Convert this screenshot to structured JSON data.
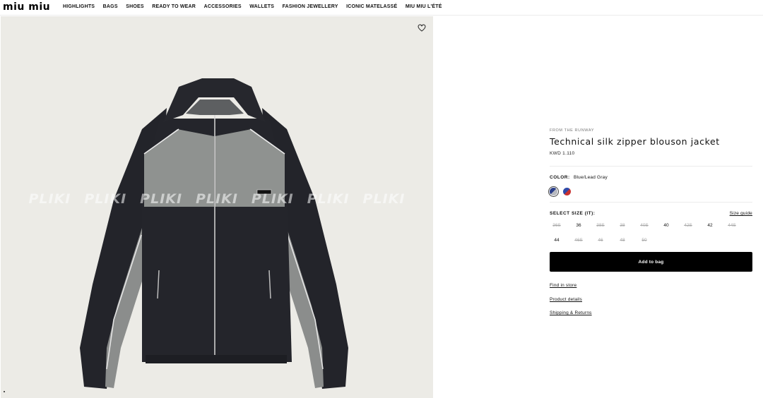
{
  "header": {
    "logo": "miu miu",
    "nav": [
      {
        "label": "HIGHLIGHTS"
      },
      {
        "label": "BAGS"
      },
      {
        "label": "SHOES"
      },
      {
        "label": "READY TO WEAR"
      },
      {
        "label": "ACCESSORIES"
      },
      {
        "label": "WALLETS"
      },
      {
        "label": "FASHION JEWELLERY"
      },
      {
        "label": "ICONIC MATELASSÉ"
      },
      {
        "label": "MIU MIU L'ÉTÉ"
      }
    ]
  },
  "gallery": {
    "favorite_icon": "heart-outline-icon",
    "watermark": [
      "PLIKI",
      "PLIKI",
      "PLIKI",
      "PLIKI",
      "PLIKI",
      "PLIKI",
      "PLIKI"
    ],
    "background": "#ecebe6"
  },
  "product": {
    "eyebrow": "FROM THE RUNWAY",
    "title": "Technical silk zipper blouson jacket",
    "price": "KWD 1.110",
    "color_label": "COLOR:",
    "color_value": "Blue/Lead Gray",
    "swatches": [
      {
        "name": "Blue/Lead Gray",
        "colors": [
          "#2b3f8a",
          "#b7b9c0"
        ],
        "selected": true
      },
      {
        "name": "Blue/Red",
        "colors": [
          "#2f4aa8",
          "#c8302e"
        ],
        "selected": false
      }
    ],
    "size_label": "SELECT SIZE (IT):",
    "size_guide": "Size guide",
    "sizes": [
      {
        "label": "36S",
        "available": false
      },
      {
        "label": "36",
        "available": true
      },
      {
        "label": "38S",
        "available": false
      },
      {
        "label": "38",
        "available": false
      },
      {
        "label": "40S",
        "available": false
      },
      {
        "label": "40",
        "available": true
      },
      {
        "label": "42S",
        "available": false
      },
      {
        "label": "42",
        "available": true
      },
      {
        "label": "44S",
        "available": false
      },
      {
        "label": "44",
        "available": true
      },
      {
        "label": "46S",
        "available": false
      },
      {
        "label": "46",
        "available": false
      },
      {
        "label": "48",
        "available": false
      },
      {
        "label": "50",
        "available": false
      }
    ],
    "add_to_bag": "Add to bag",
    "links": [
      {
        "label": "Find in store"
      },
      {
        "label": "Product details"
      },
      {
        "label": "Shipping & Returns"
      }
    ]
  }
}
